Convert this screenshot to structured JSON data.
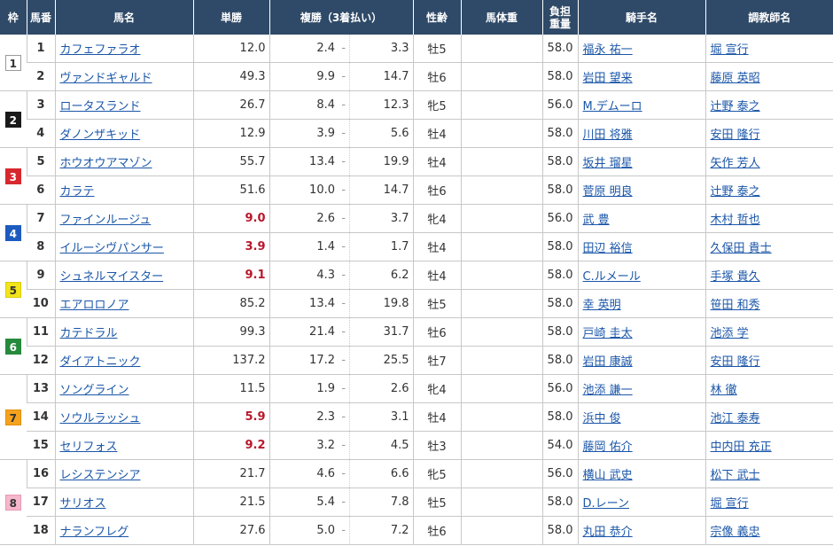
{
  "headers": {
    "waku": "枠",
    "umaban": "馬番",
    "name": "馬名",
    "win": "単勝",
    "place": "複勝（3着払い）",
    "sexage": "性齢",
    "weight": "馬体重",
    "kinryo": "負担重量",
    "jockey": "騎手名",
    "trainer": "調教師名"
  },
  "frames": [
    {
      "label": "1",
      "bg": "#ffffff",
      "fg": "#333333",
      "border": "#999999"
    },
    {
      "label": "2",
      "bg": "#1a1a1a",
      "fg": "#ffffff",
      "border": "#1a1a1a"
    },
    {
      "label": "3",
      "bg": "#d7282f",
      "fg": "#ffffff",
      "border": "#d7282f"
    },
    {
      "label": "4",
      "bg": "#1d5bbf",
      "fg": "#ffffff",
      "border": "#1d5bbf"
    },
    {
      "label": "5",
      "bg": "#f2e41a",
      "fg": "#333333",
      "border": "#d9cc10"
    },
    {
      "label": "6",
      "bg": "#268a3c",
      "fg": "#ffffff",
      "border": "#268a3c"
    },
    {
      "label": "7",
      "bg": "#f5a21e",
      "fg": "#333333",
      "border": "#e09010"
    },
    {
      "label": "8",
      "bg": "#f6b6cb",
      "fg": "#333333",
      "border": "#e79ab3"
    }
  ],
  "horses": [
    {
      "frame": 1,
      "num": "1",
      "name": "カフェファラオ",
      "win": "12.0",
      "pop": false,
      "pmin": "2.4",
      "pmax": "3.3",
      "sexage": "牡5",
      "weight": "",
      "kinryo": "58.0",
      "jockey": "福永 祐一",
      "trainer": "堀 宣行"
    },
    {
      "frame": 1,
      "num": "2",
      "name": "ヴァンドギャルド",
      "win": "49.3",
      "pop": false,
      "pmin": "9.9",
      "pmax": "14.7",
      "sexage": "牡6",
      "weight": "",
      "kinryo": "58.0",
      "jockey": "岩田 望来",
      "trainer": "藤原 英昭"
    },
    {
      "frame": 2,
      "num": "3",
      "name": "ロータスランド",
      "win": "26.7",
      "pop": false,
      "pmin": "8.4",
      "pmax": "12.3",
      "sexage": "牝5",
      "weight": "",
      "kinryo": "56.0",
      "jockey": "M.デムーロ",
      "trainer": "辻野 泰之"
    },
    {
      "frame": 2,
      "num": "4",
      "name": "ダノンザキッド",
      "win": "12.9",
      "pop": false,
      "pmin": "3.9",
      "pmax": "5.6",
      "sexage": "牡4",
      "weight": "",
      "kinryo": "58.0",
      "jockey": "川田 将雅",
      "trainer": "安田 隆行"
    },
    {
      "frame": 3,
      "num": "5",
      "name": "ホウオウアマゾン",
      "win": "55.7",
      "pop": false,
      "pmin": "13.4",
      "pmax": "19.9",
      "sexage": "牡4",
      "weight": "",
      "kinryo": "58.0",
      "jockey": "坂井 瑠星",
      "trainer": "矢作 芳人"
    },
    {
      "frame": 3,
      "num": "6",
      "name": "カラテ",
      "win": "51.6",
      "pop": false,
      "pmin": "10.0",
      "pmax": "14.7",
      "sexage": "牡6",
      "weight": "",
      "kinryo": "58.0",
      "jockey": "菅原 明良",
      "trainer": "辻野 泰之"
    },
    {
      "frame": 4,
      "num": "7",
      "name": "ファインルージュ",
      "win": "9.0",
      "pop": true,
      "pmin": "2.6",
      "pmax": "3.7",
      "sexage": "牝4",
      "weight": "",
      "kinryo": "56.0",
      "jockey": "武 豊",
      "trainer": "木村 哲也"
    },
    {
      "frame": 4,
      "num": "8",
      "name": "イルーシヴパンサー",
      "win": "3.9",
      "pop": true,
      "pmin": "1.4",
      "pmax": "1.7",
      "sexage": "牡4",
      "weight": "",
      "kinryo": "58.0",
      "jockey": "田辺 裕信",
      "trainer": "久保田 貴士"
    },
    {
      "frame": 5,
      "num": "9",
      "name": "シュネルマイスター",
      "win": "9.1",
      "pop": true,
      "pmin": "4.3",
      "pmax": "6.2",
      "sexage": "牡4",
      "weight": "",
      "kinryo": "58.0",
      "jockey": "C.ルメール",
      "trainer": "手塚 貴久"
    },
    {
      "frame": 5,
      "num": "10",
      "name": "エアロロノア",
      "win": "85.2",
      "pop": false,
      "pmin": "13.4",
      "pmax": "19.8",
      "sexage": "牡5",
      "weight": "",
      "kinryo": "58.0",
      "jockey": "幸 英明",
      "trainer": "笹田 和秀"
    },
    {
      "frame": 6,
      "num": "11",
      "name": "カテドラル",
      "win": "99.3",
      "pop": false,
      "pmin": "21.4",
      "pmax": "31.7",
      "sexage": "牡6",
      "weight": "",
      "kinryo": "58.0",
      "jockey": "戸崎 圭太",
      "trainer": "池添 学"
    },
    {
      "frame": 6,
      "num": "12",
      "name": "ダイアトニック",
      "win": "137.2",
      "pop": false,
      "pmin": "17.2",
      "pmax": "25.5",
      "sexage": "牡7",
      "weight": "",
      "kinryo": "58.0",
      "jockey": "岩田 康誠",
      "trainer": "安田 隆行"
    },
    {
      "frame": 7,
      "num": "13",
      "name": "ソングライン",
      "win": "11.5",
      "pop": false,
      "pmin": "1.9",
      "pmax": "2.6",
      "sexage": "牝4",
      "weight": "",
      "kinryo": "56.0",
      "jockey": "池添 謙一",
      "trainer": "林 徹"
    },
    {
      "frame": 7,
      "num": "14",
      "name": "ソウルラッシュ",
      "win": "5.9",
      "pop": true,
      "pmin": "2.3",
      "pmax": "3.1",
      "sexage": "牡4",
      "weight": "",
      "kinryo": "58.0",
      "jockey": "浜中 俊",
      "trainer": "池江 泰寿"
    },
    {
      "frame": 7,
      "num": "15",
      "name": "セリフォス",
      "win": "9.2",
      "pop": true,
      "pmin": "3.2",
      "pmax": "4.5",
      "sexage": "牡3",
      "weight": "",
      "kinryo": "54.0",
      "jockey": "藤岡 佑介",
      "trainer": "中内田 充正"
    },
    {
      "frame": 8,
      "num": "16",
      "name": "レシステンシア",
      "win": "21.7",
      "pop": false,
      "pmin": "4.6",
      "pmax": "6.6",
      "sexage": "牝5",
      "weight": "",
      "kinryo": "56.0",
      "jockey": "横山 武史",
      "trainer": "松下 武士"
    },
    {
      "frame": 8,
      "num": "17",
      "name": "サリオス",
      "win": "21.5",
      "pop": false,
      "pmin": "5.4",
      "pmax": "7.8",
      "sexage": "牡5",
      "weight": "",
      "kinryo": "58.0",
      "jockey": "D.レーン",
      "trainer": "堀 宣行"
    },
    {
      "frame": 8,
      "num": "18",
      "name": "ナランフレグ",
      "win": "27.6",
      "pop": false,
      "pmin": "5.0",
      "pmax": "7.2",
      "sexage": "牡6",
      "weight": "",
      "kinryo": "58.0",
      "jockey": "丸田 恭介",
      "trainer": "宗像 義忠"
    }
  ],
  "place_separator": "-",
  "kinryo_header": [
    "負担",
    "重量"
  ]
}
